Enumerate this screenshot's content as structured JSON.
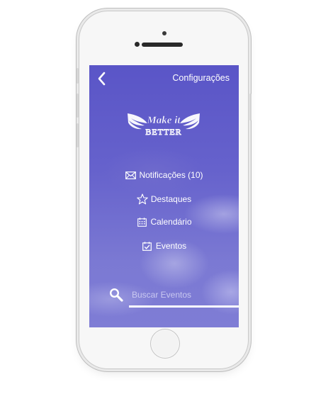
{
  "header": {
    "back_icon": "chevron-left-icon",
    "settings_label": "Configurações"
  },
  "logo": {
    "line1": "Make it",
    "line2": "BETTER"
  },
  "menu": [
    {
      "icon": "envelope-icon",
      "label": "Notificações (10)"
    },
    {
      "icon": "star-icon",
      "label": "Destaques"
    },
    {
      "icon": "calendar-icon",
      "label": "Calendário"
    },
    {
      "icon": "event-check-icon",
      "label": "Eventos"
    }
  ],
  "search": {
    "icon": "search-icon",
    "placeholder": "Buscar Eventos",
    "value": ""
  },
  "colors": {
    "screen_top": "#5a55c7",
    "screen_bottom": "#7f7dd5",
    "text": "#ffffff"
  }
}
